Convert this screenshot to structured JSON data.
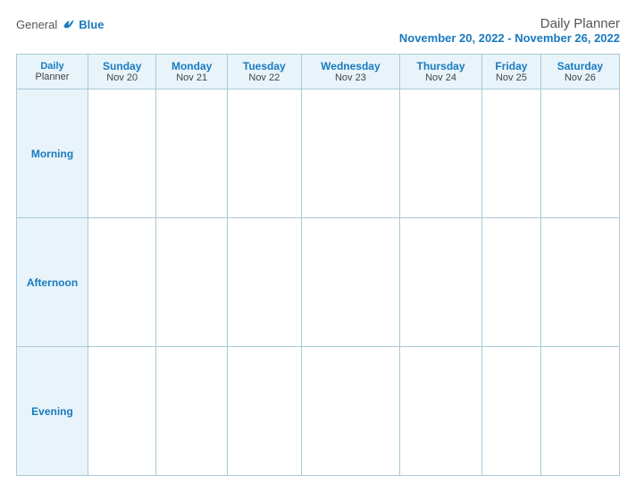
{
  "header": {
    "logo_general": "General",
    "logo_blue": "Blue",
    "title": "Daily Planner",
    "date_range": "November 20, 2022 - November 26, 2022"
  },
  "columns": [
    {
      "id": "label",
      "day": "Daily",
      "sub": "Planner"
    },
    {
      "id": "sun",
      "day": "Sunday",
      "sub": "Nov 20"
    },
    {
      "id": "mon",
      "day": "Monday",
      "sub": "Nov 21"
    },
    {
      "id": "tue",
      "day": "Tuesday",
      "sub": "Nov 22"
    },
    {
      "id": "wed",
      "day": "Wednesday",
      "sub": "Nov 23"
    },
    {
      "id": "thu",
      "day": "Thursday",
      "sub": "Nov 24"
    },
    {
      "id": "fri",
      "day": "Friday",
      "sub": "Nov 25"
    },
    {
      "id": "sat",
      "day": "Saturday",
      "sub": "Nov 26"
    }
  ],
  "rows": [
    {
      "id": "morning",
      "label": "Morning"
    },
    {
      "id": "afternoon",
      "label": "Afternoon"
    },
    {
      "id": "evening",
      "label": "Evening"
    }
  ]
}
